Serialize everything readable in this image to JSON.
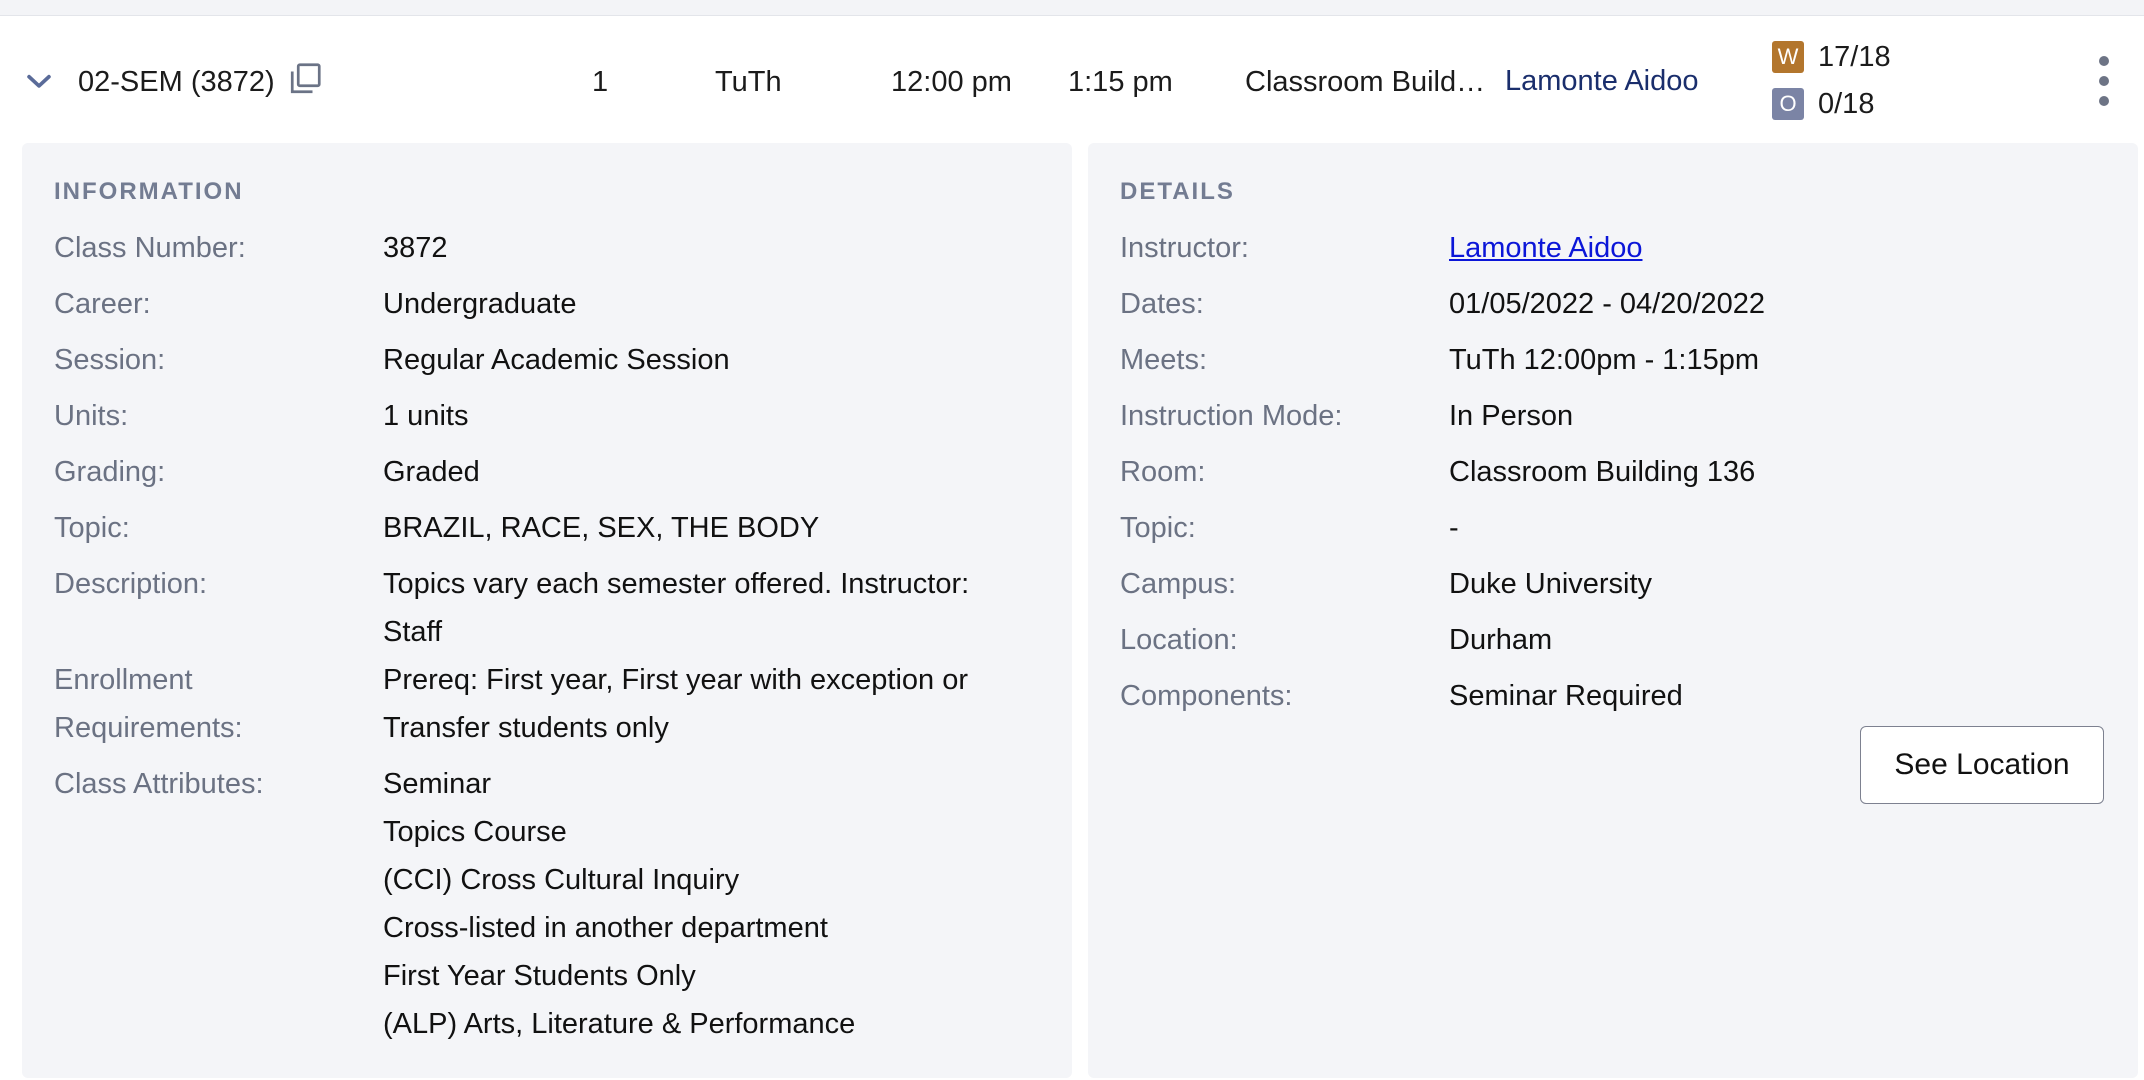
{
  "row": {
    "section": "02-SEM (3872)",
    "units": "1",
    "days": "TuTh",
    "start": "12:00 pm",
    "end": "1:15 pm",
    "room": "Classroom Build…",
    "instructor": "Lamonte Aidoo",
    "seats": {
      "w_badge": "W",
      "w_count": "17/18",
      "o_badge": "O",
      "o_count": "0/18"
    }
  },
  "information": {
    "heading": "INFORMATION",
    "class_number_label": "Class Number:",
    "class_number": "3872",
    "career_label": "Career:",
    "career": "Undergraduate",
    "session_label": "Session:",
    "session": "Regular Academic Session",
    "units_label": "Units:",
    "units": "1 units",
    "grading_label": "Grading:",
    "grading": "Graded",
    "topic_label": "Topic:",
    "topic": "BRAZIL, RACE, SEX, THE BODY",
    "description_label": "Description:",
    "description_line1": "Topics vary each semester offered. Instructor:",
    "description_line2": "Staff",
    "enroll_label_line1": "Enrollment",
    "enroll_label_line2": "Requirements:",
    "enroll_line1": "Prereq: First year, First year with exception or",
    "enroll_line2": "Transfer students only",
    "attributes_label": "Class Attributes:",
    "attributes": [
      "Seminar",
      "Topics Course",
      "(CCI) Cross Cultural Inquiry",
      "Cross-listed in another department",
      "First Year Students Only",
      "(ALP) Arts, Literature & Performance"
    ]
  },
  "details": {
    "heading": "DETAILS",
    "instructor_label": "Instructor:",
    "instructor": "Lamonte Aidoo",
    "dates_label": "Dates:",
    "dates": "01/05/2022 - 04/20/2022",
    "meets_label": "Meets:",
    "meets": "TuTh 12:00pm - 1:15pm",
    "mode_label": "Instruction Mode:",
    "mode": "In Person",
    "room_label": "Room:",
    "room": "Classroom Building 136",
    "topic_label": "Topic:",
    "topic": "-",
    "campus_label": "Campus:",
    "campus": "Duke University",
    "location_label": "Location:",
    "location": "Durham",
    "components_label": "Components:",
    "components": "Seminar Required",
    "see_location": "See Location"
  },
  "colors": {
    "w_badge": "#b3762d",
    "o_badge": "#7b84a5",
    "link": "#0b16d8",
    "panel_bg": "#f4f5f8"
  }
}
